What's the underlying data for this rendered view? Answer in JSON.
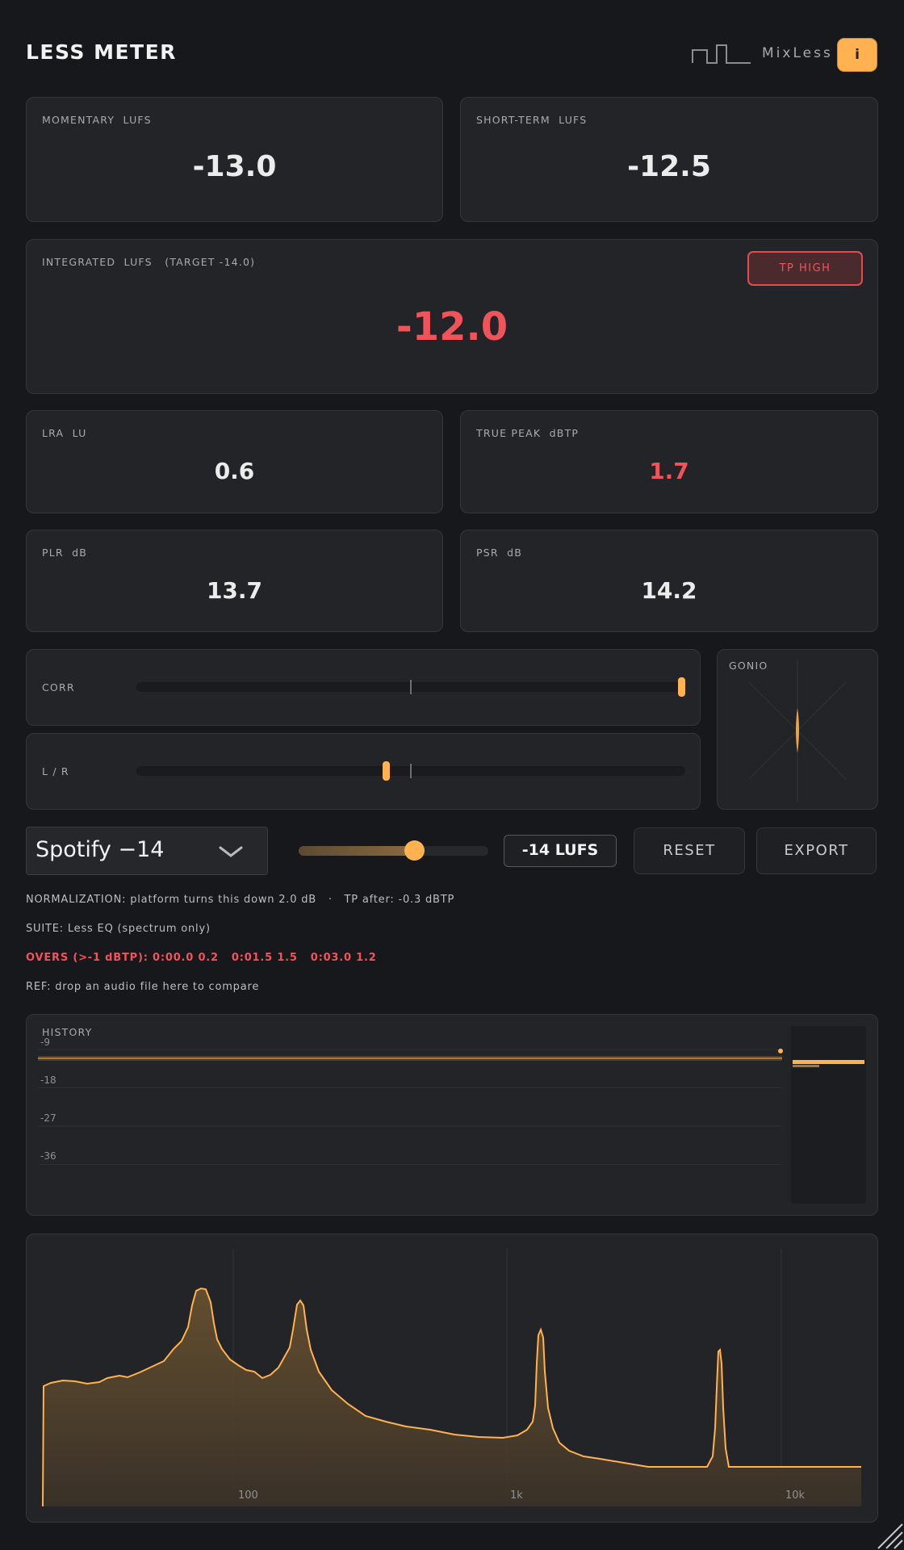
{
  "header": {
    "title": "LESS METER",
    "brand": "MixLess",
    "info_button": "i"
  },
  "momentary": {
    "label": "MOMENTARY  LUFS",
    "value": "-13.0"
  },
  "short_term": {
    "label": "SHORT-TERM  LUFS",
    "value": "-12.5"
  },
  "integrated": {
    "label": "INTEGRATED  LUFS   (TARGET -14.0)",
    "value": "-12.0",
    "badge": "TP HIGH"
  },
  "lra": {
    "label": "LRA  LU",
    "value": "0.6"
  },
  "true_peak": {
    "label": "TRUE PEAK  dBTP",
    "value": "1.7"
  },
  "plr": {
    "label": "PLR  dB",
    "value": "13.7"
  },
  "psr": {
    "label": "PSR  dB",
    "value": "14.2"
  },
  "correlation": {
    "label": "CORR",
    "position": 1.0
  },
  "balance": {
    "label": "L / R",
    "position": -0.09
  },
  "gonio": {
    "label": "GONIO"
  },
  "controls": {
    "preset": "Spotify −14",
    "target_slider_fraction": 0.61,
    "target_readout": "-14 LUFS",
    "reset": "RESET",
    "export": "EXPORT"
  },
  "info": {
    "normalization": "NORMALIZATION: platform turns this down 2.0 dB   ·   TP after: -0.3 dBTP",
    "suite": "SUITE: Less EQ (spectrum only)",
    "overs": "OVERS (>-1 dBTP): 0:00.0 0.2   0:01.5 1.5   0:03.0 1.2",
    "ref": "REF: drop an audio file here to compare"
  },
  "history": {
    "label": "HISTORY",
    "ticks": [
      "-9",
      "-18",
      "-27",
      "-36"
    ],
    "ylim": [
      -45,
      -9
    ],
    "current_lufs": -14.1
  },
  "spectrum": {
    "ticks": [
      "100",
      "1k",
      "10k"
    ],
    "xlim_hz": [
      20,
      20000
    ],
    "peaks_hz": [
      90,
      250,
      1050,
      7800
    ]
  },
  "colors": {
    "accent": "#ffb24f",
    "alert": "#f0545b",
    "panel": "#222428",
    "background": "#17181b"
  }
}
